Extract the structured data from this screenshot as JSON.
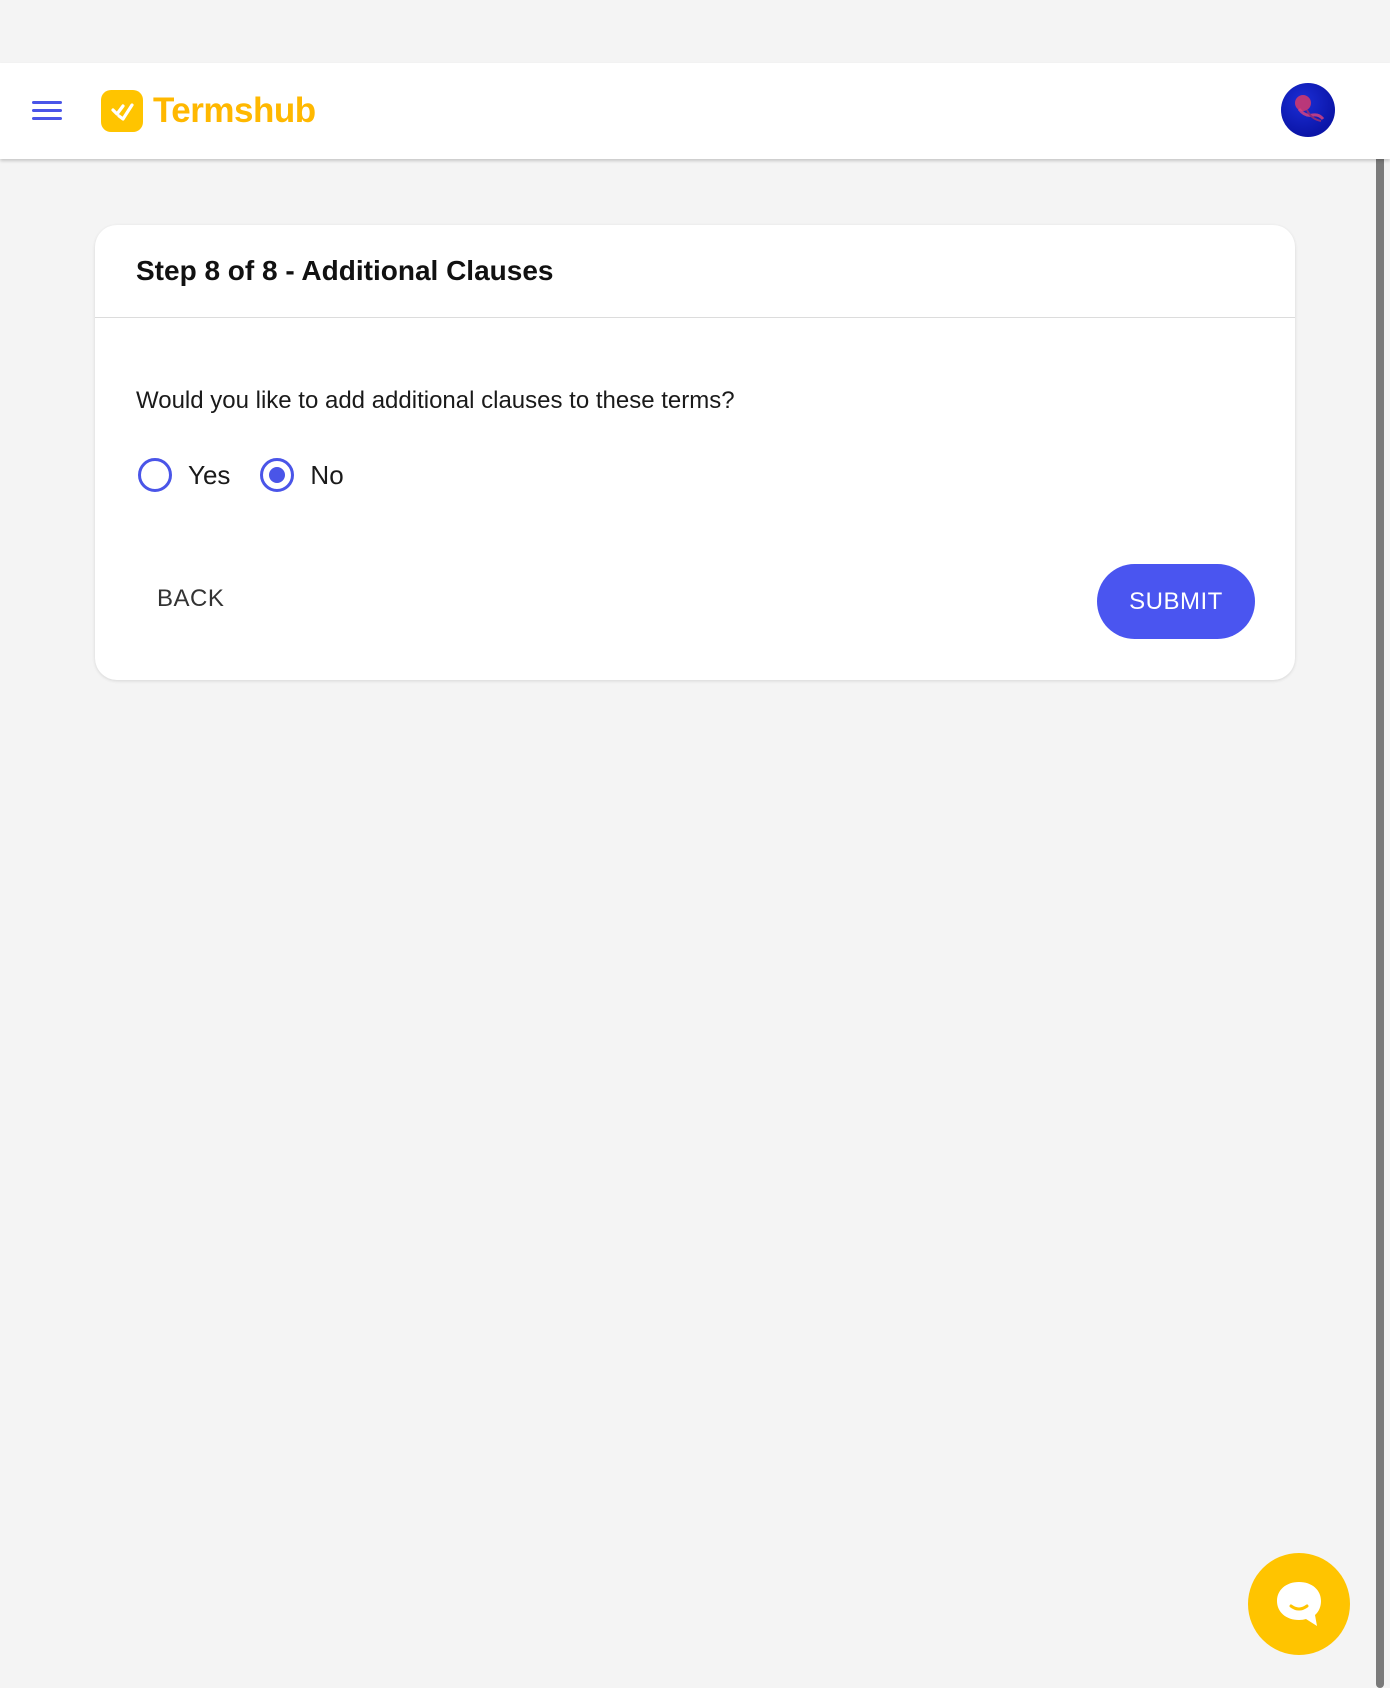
{
  "header": {
    "menu_icon": "hamburger-menu-icon",
    "logo_text": "Termshub",
    "avatar_icon": "user-avatar"
  },
  "card": {
    "title": "Step 8 of 8 - Additional Clauses",
    "question": "Would you like to add additional clauses to these terms?",
    "options": [
      {
        "label": "Yes",
        "selected": false
      },
      {
        "label": "No",
        "selected": true
      }
    ],
    "back_label": "BACK",
    "submit_label": "SUBMIT"
  },
  "chat": {
    "icon": "chat-bubble-icon"
  },
  "colors": {
    "accent": "#4a55f0",
    "brand": "#ffc400",
    "background": "#f4f4f4"
  }
}
